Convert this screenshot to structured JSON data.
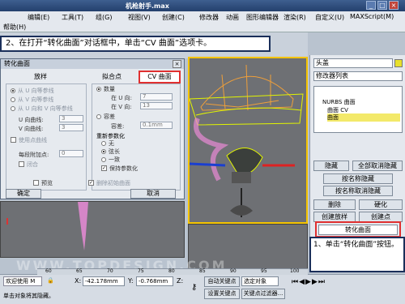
{
  "window": {
    "title": "机枪射手.max"
  },
  "menu": {
    "row1": [
      "编辑(E)",
      "工具(T)",
      "组(G)",
      "视图(V)",
      "创建(C)",
      "修改器",
      "动画",
      "图形编辑器",
      "渲染(R)",
      "自定义(U)",
      "MAXScript(M)"
    ],
    "row2": [
      "帮助(H)"
    ]
  },
  "step_banner": "2、在打开“转化曲面”对话框中，单击“CV 曲面”选项卡。",
  "dialog": {
    "title": "转化曲面",
    "tabs": {
      "loft": "放样",
      "fit": "拟合点",
      "cv": "CV 曲面"
    },
    "left_group": {
      "from_u_iso": "从 U 向等参线",
      "from_v_iso": "从 V 向等参线",
      "from_uv_iso": "从 U 向和 V 向等参线",
      "u_curves_label": "U 向曲线:",
      "u_curves_value": "3",
      "v_curves_label": "V 向曲线:",
      "v_curves_value": "3",
      "use_point_curves": "使用点曲线",
      "extra_per_segment_label": "每段附加点:",
      "extra_per_segment_value": "0",
      "close": "闭合"
    },
    "right_group": {
      "count": "数量",
      "in_u_label": "在 U 向:",
      "in_u_value": "7",
      "in_v_label": "在 V 向:",
      "in_v_value": "13",
      "tolerance": "容差",
      "tolerance_label": "容差:",
      "tolerance_value": "0.1mm",
      "reparam_title": "重新参数化",
      "none": "无",
      "chord_length": "弦长",
      "uniform": "一致",
      "keep_params": "保持参数化"
    },
    "preview": "预览",
    "delete_original": "删除初始曲面",
    "ok": "确定",
    "cancel": "取消"
  },
  "command_panel": {
    "object_name": "头盖",
    "modifier_list": "修改器列表",
    "stack": [
      "NURBS 曲面",
      "曲面 CV",
      "曲面"
    ],
    "buttons": {
      "hide": "隐藏",
      "unhide_all": "全部取消隐藏",
      "hide_by_name": "按名称隐藏",
      "unhide_by_name": "按名称取消隐藏",
      "delete": "删除",
      "harden": "硬化",
      "create_loft": "创建放样",
      "create_cv_surface": "创建点",
      "convert_surface": "转化曲面"
    }
  },
  "callout": "1、单击“转化曲面”按钮。",
  "statusbar": {
    "welcome": "欢迎使用 M",
    "prompt": "单击对象将其隐藏。",
    "x_label": "X:",
    "x_value": "-42.178mm",
    "y_label": "Y:",
    "y_value": "-0.768mm",
    "z_label": "Z:",
    "auto_key": "自动关键点",
    "set_key": "设置关键点",
    "selected_object": "选定对象",
    "key_filters": "关键点过滤器...",
    "timeline": [
      "60",
      "65",
      "70",
      "75",
      "80",
      "85",
      "90",
      "95",
      "100"
    ]
  },
  "watermark": "WWW.TOPDESIGN.COM"
}
